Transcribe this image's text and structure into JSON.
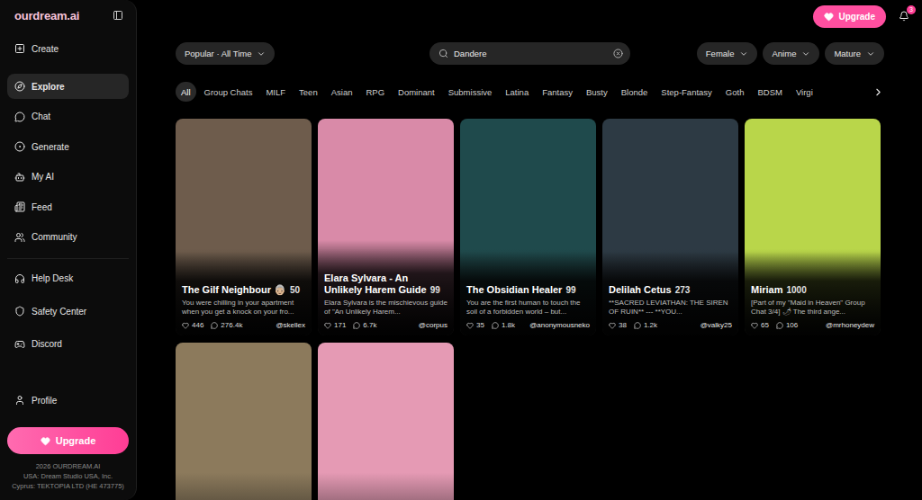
{
  "brand": {
    "logo": "ourdream.ai"
  },
  "sidebar": {
    "sections": [
      {
        "items": [
          {
            "label": "Create",
            "selected": false
          }
        ]
      },
      {
        "items": [
          {
            "label": "Explore",
            "selected": true
          },
          {
            "label": "Chat",
            "selected": false
          },
          {
            "label": "Generate",
            "selected": false
          },
          {
            "label": "My AI",
            "selected": false
          },
          {
            "label": "Feed",
            "selected": false
          },
          {
            "label": "Community",
            "selected": false
          }
        ]
      },
      {
        "items": [
          {
            "label": "Help Desk",
            "selected": false
          },
          {
            "label": "Safety Center",
            "selected": false
          },
          {
            "label": "Discord",
            "selected": false
          }
        ]
      }
    ],
    "profile": "Profile",
    "upgrade": "Upgrade",
    "footer": [
      "2026 OURDREAM.AI",
      "USA: Dream Studio USA, Inc.",
      "Cyprus: TEKTOPIA LTD (HE 473775)"
    ]
  },
  "header": {
    "upgrade": "Upgrade",
    "notifications": "3"
  },
  "filters": {
    "sort": "Popular · All Time",
    "search": "Dandere",
    "dropdowns": [
      "Female",
      "Anime",
      "Mature"
    ]
  },
  "tags": [
    {
      "label": "All",
      "selected": true
    },
    {
      "label": "Group Chats",
      "selected": false
    },
    {
      "label": "MILF",
      "selected": false
    },
    {
      "label": "Teen",
      "selected": false
    },
    {
      "label": "Asian",
      "selected": false
    },
    {
      "label": "RPG",
      "selected": false
    },
    {
      "label": "Dominant",
      "selected": false
    },
    {
      "label": "Submissive",
      "selected": false
    },
    {
      "label": "Latina",
      "selected": false
    },
    {
      "label": "Fantasy",
      "selected": false
    },
    {
      "label": "Busty",
      "selected": false
    },
    {
      "label": "Blonde",
      "selected": false
    },
    {
      "label": "Step-Fantasy",
      "selected": false
    },
    {
      "label": "Goth",
      "selected": false
    },
    {
      "label": "BDSM",
      "selected": false
    },
    {
      "label": "Virgi",
      "selected": false
    }
  ],
  "cards": [
    {
      "kind": "profile",
      "title": "The Gilf Neighbour 👵🏼",
      "count": "50",
      "description": "You were chilling in your apartment when you get a knock on your fro...",
      "likes": "446",
      "chats": "276.4k",
      "author": "@skellex",
      "color": "#6e5c4c"
    },
    {
      "kind": "profile",
      "title": "Elara Sylvara - An Unlikely Harem Guide",
      "count": "99",
      "description": "Elara Sylvara is the mischievous guide of \"An Unlikely Harem...",
      "likes": "171",
      "chats": "6.7k",
      "author": "@corpus",
      "color": "#d98aa8"
    },
    {
      "kind": "profile",
      "title": "The Obsidian Healer",
      "count": "99",
      "description": "You are the first human to touch the soil of a forbidden world – but...",
      "likes": "35",
      "chats": "1.8k",
      "author": "@anonymousneko",
      "color": "#1f4a4c"
    },
    {
      "kind": "profile",
      "title": "Delilah Cetus",
      "count": "273",
      "description": "**SACRED LEVIATHAN: THE SIREN OF RUIN** --- **YOU...",
      "likes": "38",
      "chats": "1.2k",
      "author": "@valky25",
      "color": "#2d3a44"
    },
    {
      "kind": "profile",
      "title": "Miriam",
      "count": "1000",
      "description": "[Part of my \"Maid in Heaven\" Group Chat 3/4] 🌶 The third ange...",
      "likes": "65",
      "chats": "106",
      "author": "@mrhoneydew",
      "color": "#b9d64a"
    },
    {
      "kind": "image",
      "color": "#8c7a5c"
    },
    {
      "kind": "image",
      "color": "#e59ab4"
    }
  ]
}
